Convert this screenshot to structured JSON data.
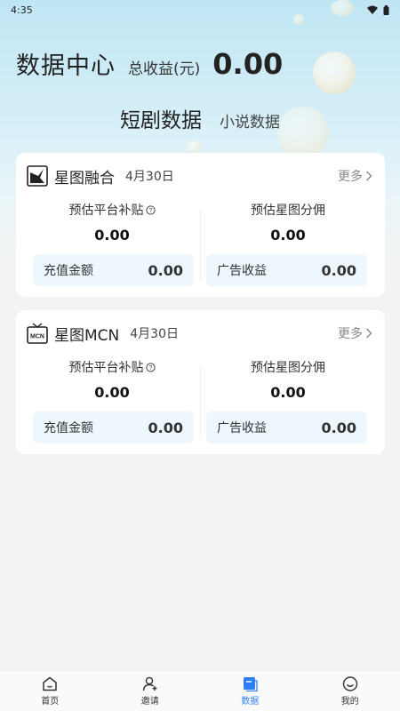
{
  "status": {
    "time": "4:35"
  },
  "header": {
    "title": "数据中心",
    "total_label": "总收益(元)",
    "total_value": "0.00"
  },
  "tabs": [
    {
      "label": "短剧数据"
    },
    {
      "label": "小说数据"
    }
  ],
  "cards": [
    {
      "title": "星图融合",
      "date": "4月30日",
      "more": "更多",
      "left_label": "预估平台补贴",
      "left_value": "0.00",
      "right_label": "预估星图分佣",
      "right_value": "0.00",
      "pill_left_label": "充值金额",
      "pill_left_value": "0.00",
      "pill_right_label": "广告收益",
      "pill_right_value": "0.00",
      "icon": "xingtu-logo-icon"
    },
    {
      "title": "星图MCN",
      "date": "4月30日",
      "more": "更多",
      "left_label": "预估平台补贴",
      "left_value": "0.00",
      "right_label": "预估星图分佣",
      "right_value": "0.00",
      "pill_left_label": "充值金额",
      "pill_left_value": "0.00",
      "pill_right_label": "广告收益",
      "pill_right_value": "0.00",
      "icon": "mcn-tv-icon",
      "icon_text": "MCN"
    }
  ],
  "nav": [
    {
      "label": "首页",
      "icon": "home-icon"
    },
    {
      "label": "邀请",
      "icon": "invite-user-icon"
    },
    {
      "label": "数据",
      "icon": "data-icon"
    },
    {
      "label": "我的",
      "icon": "profile-smile-icon"
    }
  ],
  "colors": {
    "accent": "#2f7df3",
    "pill_bg": "#eef7fd",
    "hero_top": "#bfe5f3"
  }
}
